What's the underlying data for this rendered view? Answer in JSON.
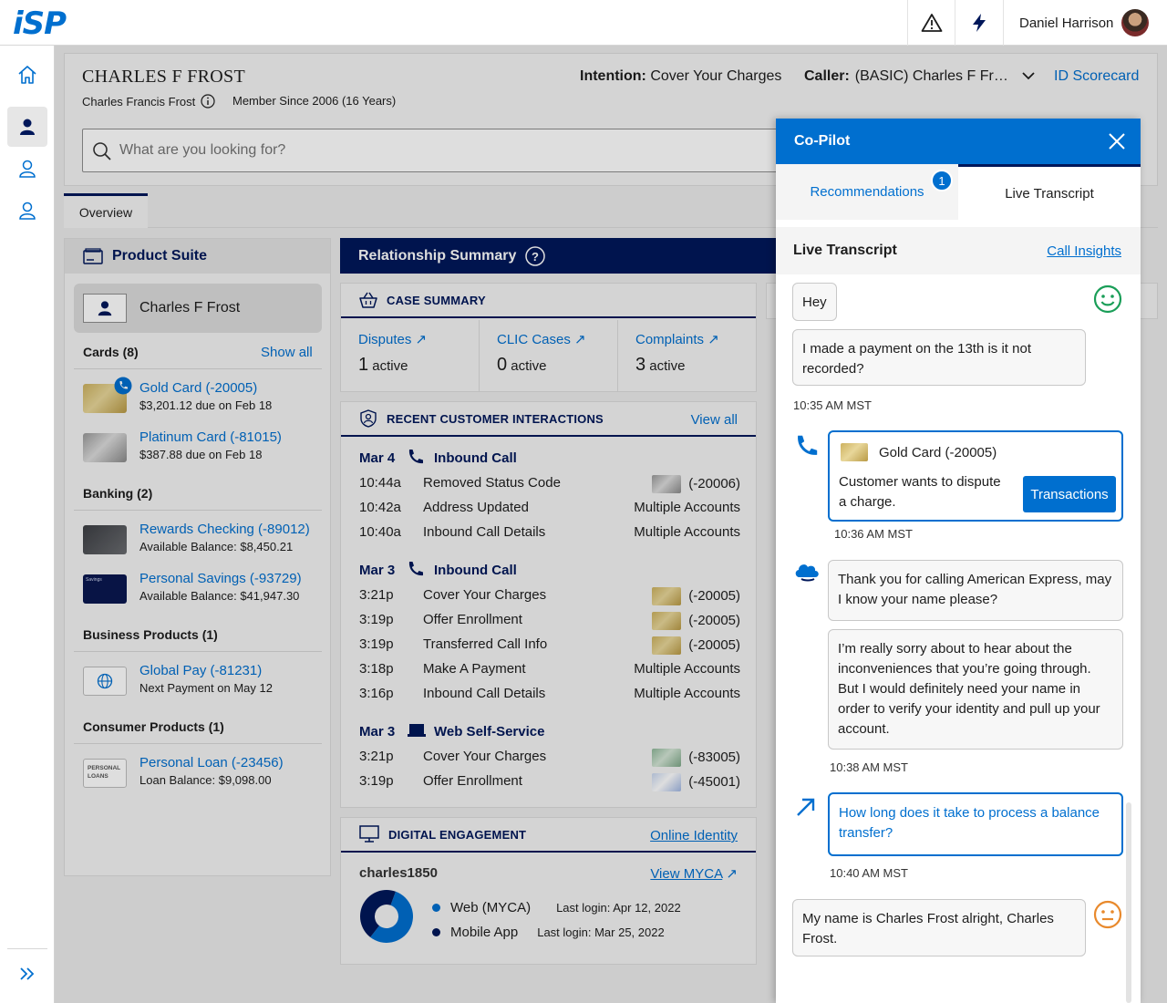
{
  "topbar": {
    "logo": "iSP",
    "user_name": "Daniel Harrison"
  },
  "customer": {
    "name": "CHARLES F FROST",
    "full_name": "Charles Francis Frost",
    "member_since": "Member Since 2006 (16 Years)",
    "intention_label": "Intention:",
    "intention_value": "Cover Your Charges",
    "caller_label": "Caller:",
    "caller_value": "(BASIC) Charles F Fr…",
    "id_scorecard": "ID Scorecard"
  },
  "search": {
    "placeholder": "What are you looking for?"
  },
  "tabs": {
    "overview": "Overview"
  },
  "product_suite": {
    "title": "Product Suite",
    "customer": "Charles F Frost",
    "cards_label": "Cards (8)",
    "show_all": "Show all",
    "cards": [
      {
        "title": "Gold Card (-20005)",
        "sub": "$3,201.12 due on Feb 18"
      },
      {
        "title": "Platinum Card (-81015)",
        "sub": "$387.88 due on Feb 18"
      }
    ],
    "banking_label": "Banking (2)",
    "banking": [
      {
        "title": "Rewards Checking (-89012)",
        "sub": "Available Balance: $8,450.21"
      },
      {
        "title": "Personal Savings (-93729)",
        "sub": "Available Balance: $41,947.30",
        "thumb_text": "Savings"
      }
    ],
    "business_label": "Business Products (1)",
    "business": [
      {
        "title": "Global Pay (-81231)",
        "sub": "Next Payment on May 12"
      }
    ],
    "consumer_label": "Consumer Products (1)",
    "consumer": [
      {
        "title": "Personal Loan (-23456)",
        "sub": "Loan Balance: $9,098.00",
        "thumb_text": "PERSONAL LOANS"
      }
    ]
  },
  "relationship": {
    "title": "Relationship Summary",
    "case_summary": {
      "title": "CASE SUMMARY",
      "items": [
        {
          "label": "Disputes",
          "count": "1",
          "unit": "active"
        },
        {
          "label": "CLIC Cases",
          "count": "0",
          "unit": "active"
        },
        {
          "label": "Complaints",
          "count": "3",
          "unit": "active"
        }
      ]
    },
    "interactions": {
      "title": "RECENT CUSTOMER INTERACTIONS",
      "view_all": "View all",
      "groups": [
        {
          "date": "Mar 4",
          "type": "Inbound Call",
          "rows": [
            {
              "time": "10:44a",
              "desc": "Removed Status Code",
              "acct": "(-20006)"
            },
            {
              "time": "10:42a",
              "desc": "Address Updated",
              "acct": "Multiple Accounts"
            },
            {
              "time": "10:40a",
              "desc": "Inbound Call Details",
              "acct": "Multiple Accounts"
            }
          ]
        },
        {
          "date": "Mar 3",
          "type": "Inbound Call",
          "rows": [
            {
              "time": "3:21p",
              "desc": "Cover Your Charges",
              "acct": "(-20005)"
            },
            {
              "time": "3:19p",
              "desc": "Offer Enrollment",
              "acct": "(-20005)"
            },
            {
              "time": "3:19p",
              "desc": "Transferred Call Info",
              "acct": "(-20005)"
            },
            {
              "time": "3:18p",
              "desc": "Make A Payment",
              "acct": "Multiple Accounts"
            },
            {
              "time": "3:16p",
              "desc": "Inbound Call Details",
              "acct": "Multiple Accounts"
            }
          ]
        },
        {
          "date": "Mar 3",
          "type": "Web Self-Service",
          "rows": [
            {
              "time": "3:21p",
              "desc": "Cover Your Charges",
              "acct": "(-83005)"
            },
            {
              "time": "3:19p",
              "desc": "Offer Enrollment",
              "acct": "(-45001)"
            }
          ]
        }
      ]
    },
    "digital": {
      "title": "DIGITAL ENGAGEMENT",
      "online_identity": "Online Identity",
      "username": "charles1850",
      "view_myca": "View MYCA",
      "channels": [
        {
          "name": "Web (MYCA)",
          "last": "Last login: Apr 12, 2022",
          "color": "#006fcf",
          "share": 0.55
        },
        {
          "name": "Mobile App",
          "last": "Last login: Mar 25, 2022",
          "color": "#00175a",
          "share": 0.45
        }
      ]
    }
  },
  "copilot": {
    "title": "Co-Pilot",
    "tab_recommendations": "Recommendations",
    "badge": "1",
    "tab_live": "Live Transcript",
    "subheader": "Live Transcript",
    "call_insights": "Call Insights",
    "messages": {
      "m1": "Hey",
      "m2": "I made a payment on the 13th is it not recorded?",
      "t1": "10:35 AM MST",
      "card": "Gold Card (-20005)",
      "card_text": "Customer wants to dispute a charge.",
      "transactions": "Transactions",
      "t2": "10:36 AM MST",
      "a1": "Thank you for calling American Express, may I know your name please?",
      "a2": "I’m really sorry about to hear about the inconveniences that you’re going through. But I would definitely need your name in order to verify your identity and pull up your account.",
      "t3": "10:38 AM MST",
      "suggest": "How long does it take to process a balance transfer?",
      "t4": "10:40 AM MST",
      "m3": "My name is Charles Frost alright, Charles Frost."
    }
  }
}
